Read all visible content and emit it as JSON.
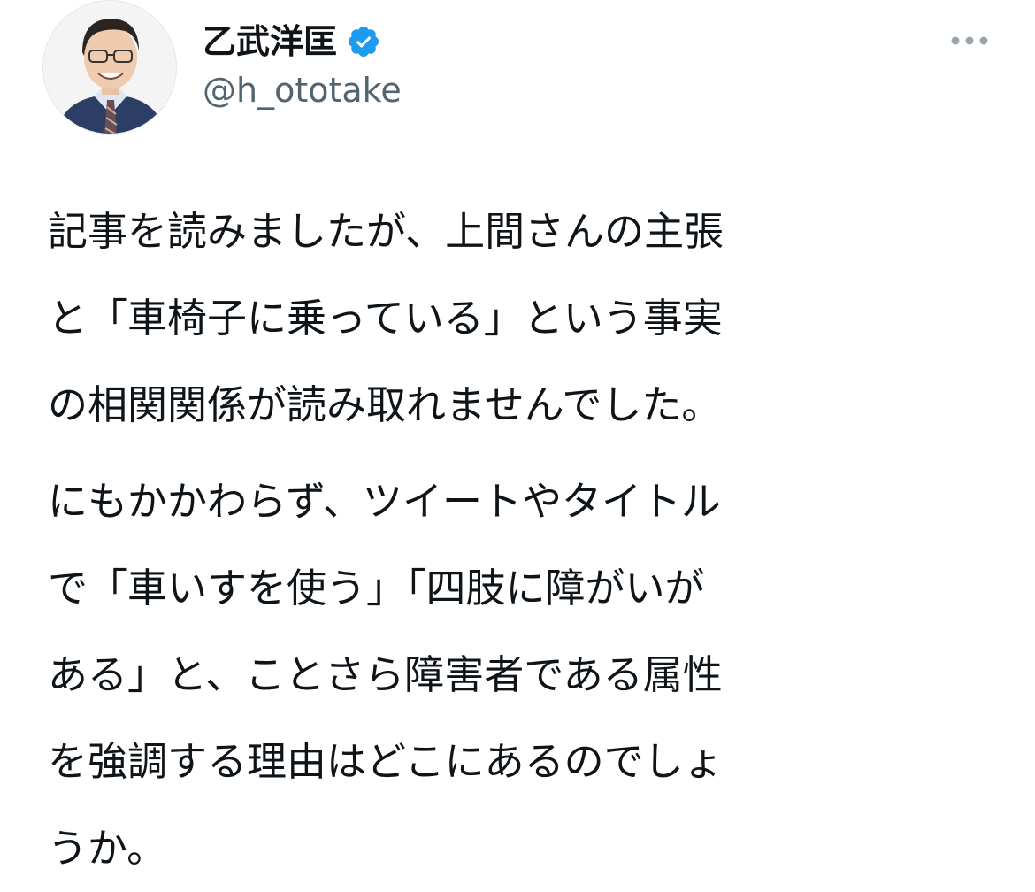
{
  "author": {
    "display_name": "乙武洋匡",
    "handle": "@h_ototake",
    "verified": true,
    "avatar_icon": "profile-photo",
    "verified_icon": "verified-badge-icon",
    "verified_color": "#1d9bf0"
  },
  "actions": {
    "more_icon": "more-dots-icon"
  },
  "tweet": {
    "paragraphs": [
      {
        "lines": [
          "記事を読みましたが、上間さんの主張",
          "と「車椅子に乗っている」という事実",
          "の相関関係が読み取れませんでした。"
        ]
      },
      {
        "lines": [
          "にもかかわらず、ツイートやタイトル",
          "で「車いすを使う」「四肢に障がいが",
          "ある」と、ことさら障害者である属性",
          "を強調する理由はどこにあるのでしょ",
          "うか。"
        ]
      }
    ]
  },
  "colors": {
    "text": "#0f1419",
    "secondary_text": "#536471",
    "more_dots": "#9aa4ad"
  }
}
